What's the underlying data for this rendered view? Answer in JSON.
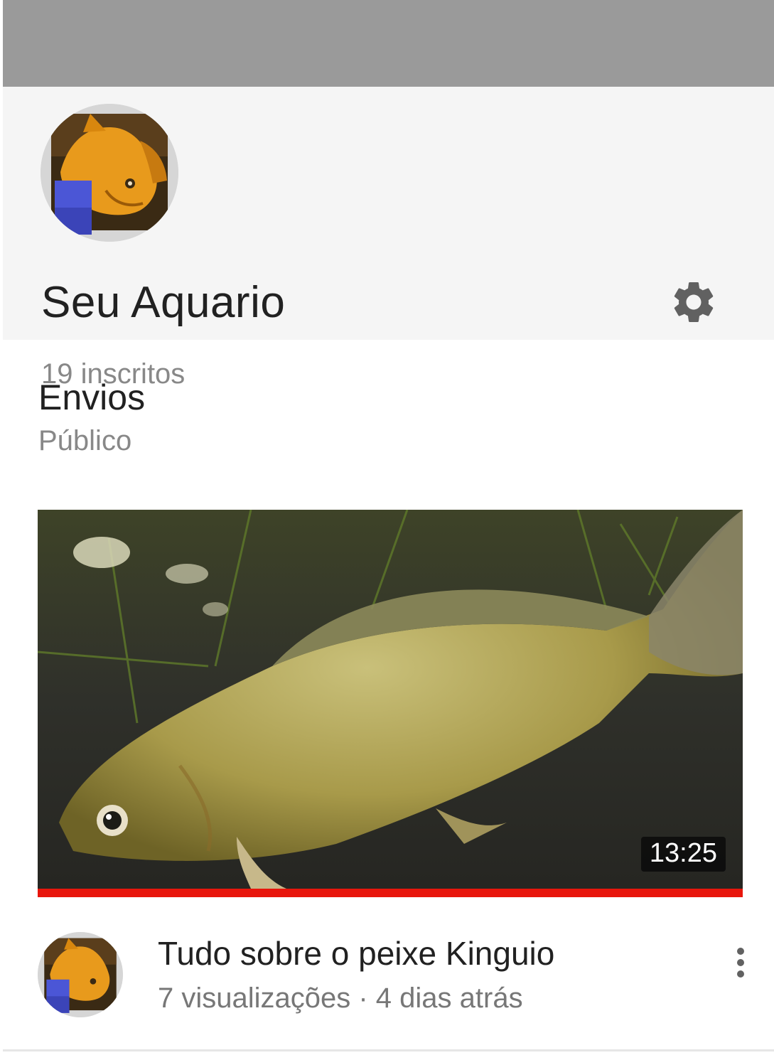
{
  "channel": {
    "name": "Seu Aquario",
    "subscribers": "19 inscritos",
    "settings_icon": "gear-icon",
    "avatar_icon": "fish-avatar"
  },
  "uploads": {
    "title": "Envios",
    "visibility": "Público"
  },
  "video": {
    "title": "Tudo sobre o peixe Kinguio",
    "views": "7 visualizações",
    "separator": " · ",
    "age": "4 dias atrás",
    "duration": "13:25",
    "watched_progress": 1.0,
    "more_icon": "more-vertical-icon"
  },
  "colors": {
    "banner": "#9a9a9a",
    "header_bg": "#f5f5f5",
    "progress": "#e8160c",
    "text_primary": "#212121",
    "text_secondary": "#888888"
  }
}
